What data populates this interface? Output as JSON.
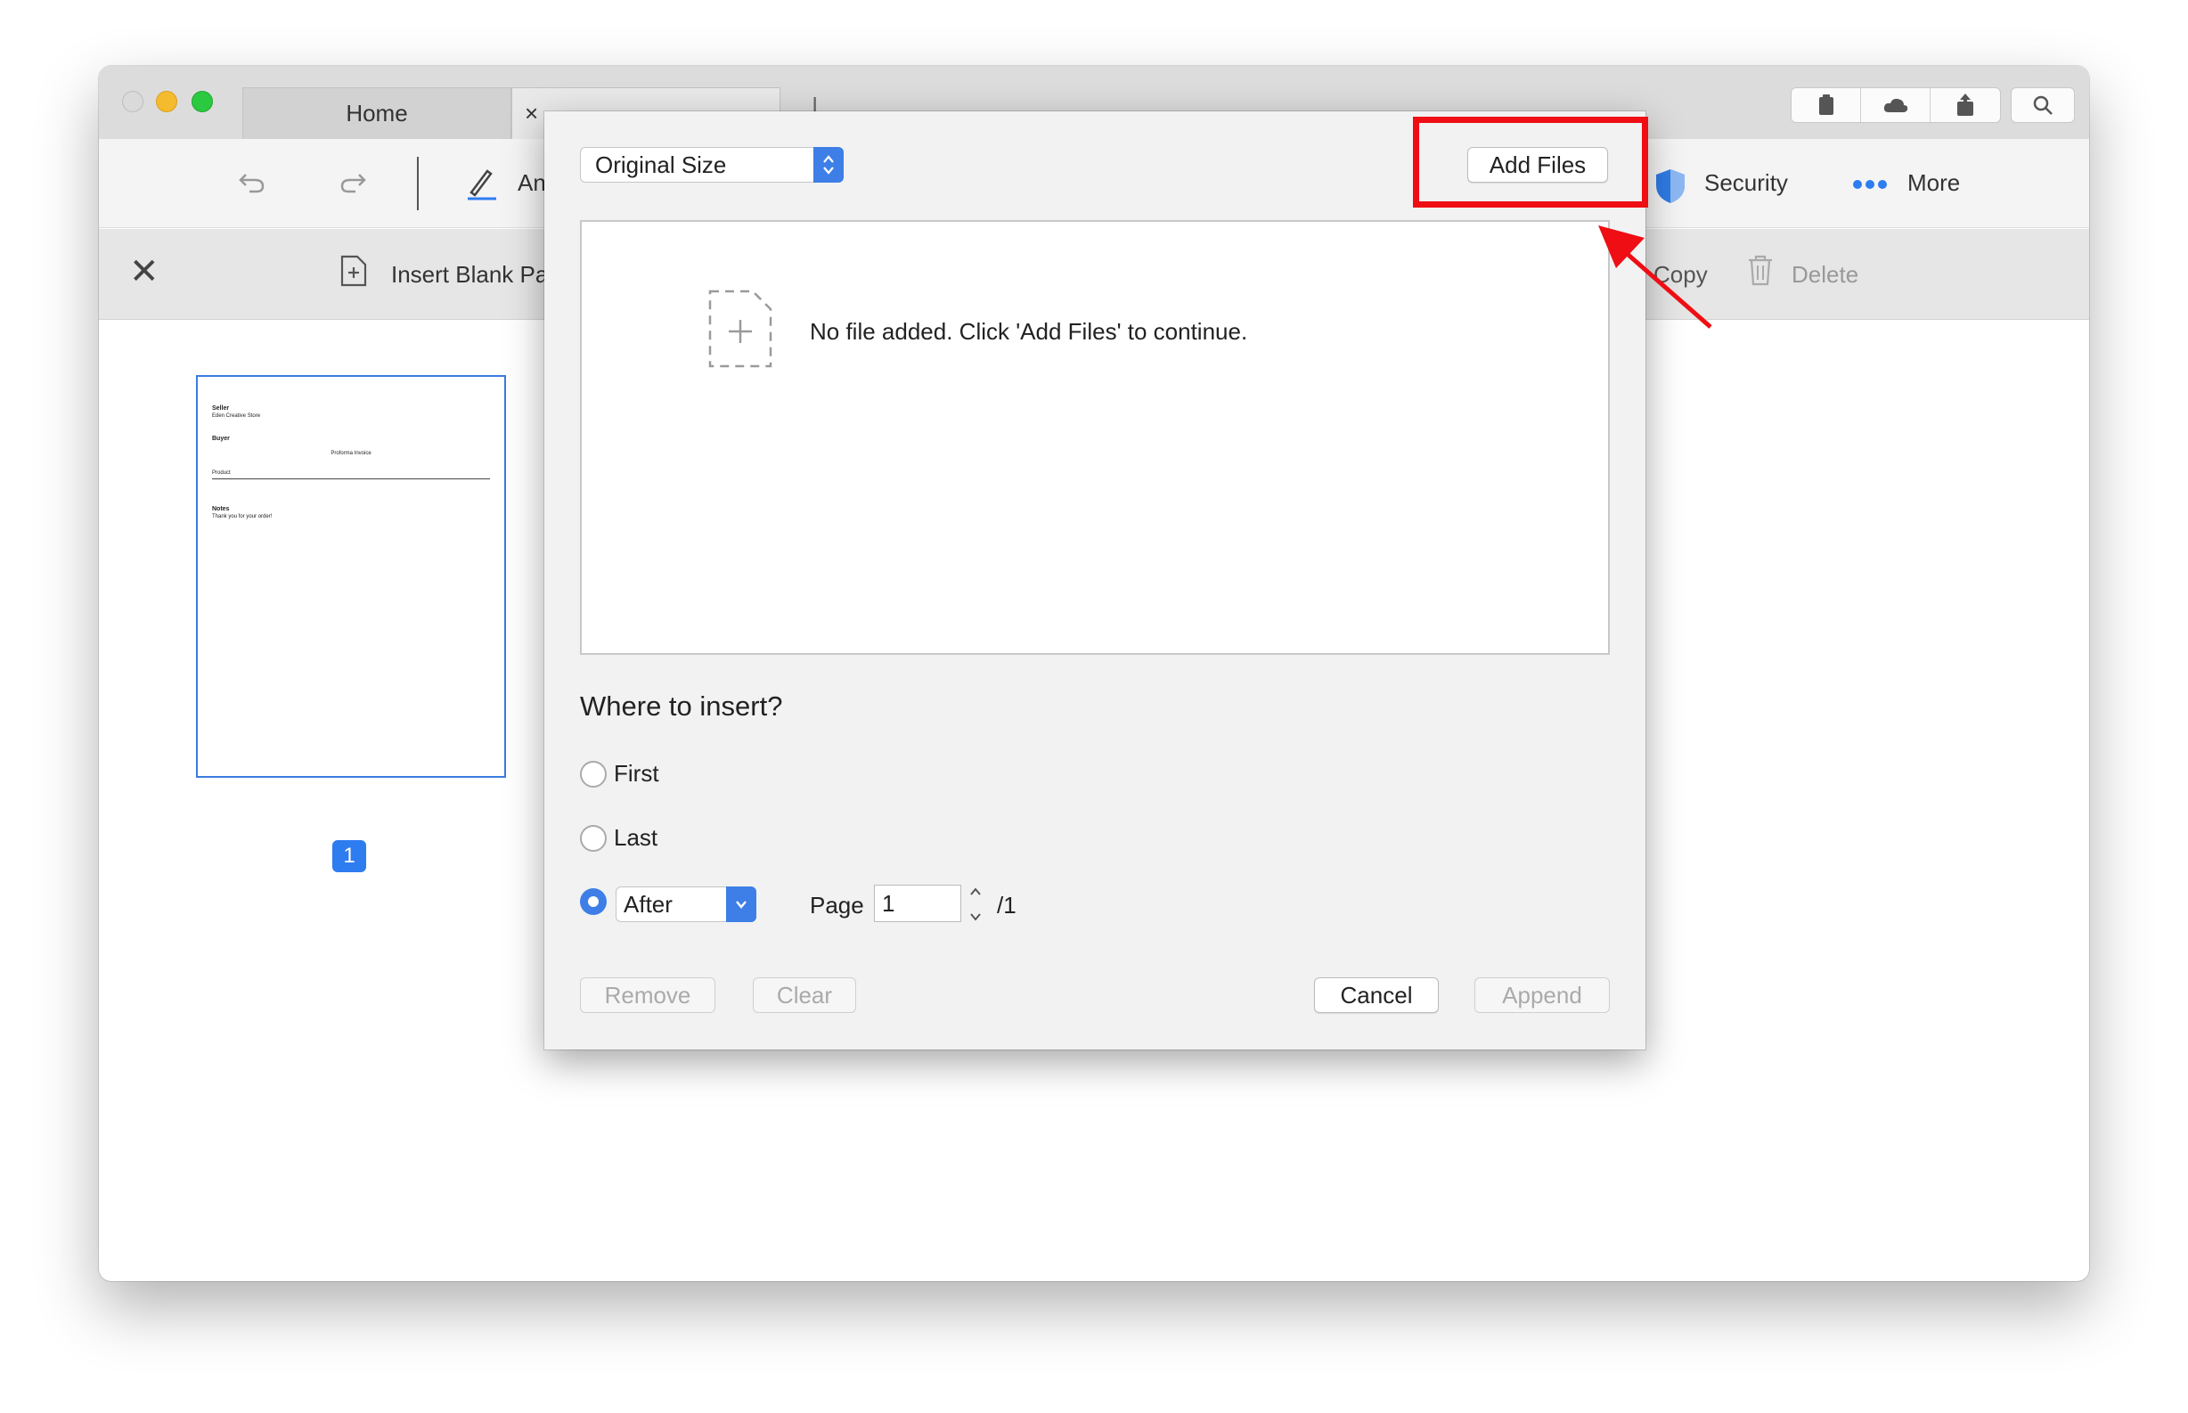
{
  "tabs": [
    {
      "label": "Home"
    },
    {
      "label": "×"
    }
  ],
  "toolbar": {
    "annotate_partial": "An",
    "security_label": "Security",
    "more_label": "More"
  },
  "pagebar": {
    "close_glyph": "✕",
    "insert_blank_label": "Insert Blank Pa",
    "copy_label": "Copy",
    "delete_label": "Delete"
  },
  "thumbnail": {
    "lines": [
      {
        "text": "Seller",
        "bold": true
      },
      {
        "text": "Eden Creative Store",
        "bold": false
      },
      {
        "text": "Buyer",
        "bold": true
      },
      {
        "text": "Proforma Invoice",
        "bold": false
      },
      {
        "text": "Product",
        "bold": false
      },
      {
        "text": "Notes",
        "bold": true
      },
      {
        "text": "Thank you for your order!",
        "bold": false
      }
    ],
    "page_number": "1"
  },
  "dialog": {
    "size_select_value": "Original Size",
    "add_files_label": "Add Files",
    "empty_message": "No file added. Click 'Add Files' to continue.",
    "where_heading": "Where to insert?",
    "options": {
      "first": "First",
      "last": "Last"
    },
    "selected_option": "after",
    "after_select_value": "After",
    "page_label": "Page",
    "page_value": "1",
    "page_total": "/1",
    "remove_label": "Remove",
    "clear_label": "Clear",
    "cancel_label": "Cancel",
    "append_label": "Append"
  },
  "colors": {
    "accent": "#3d7fe6",
    "highlight": "#ee0e14",
    "badge": "#2d7cf0",
    "security_shield": "#2f7be5"
  },
  "icons": [
    "undo-icon",
    "redo-icon",
    "pen-icon",
    "shield-icon",
    "more-icon",
    "insert-page-icon",
    "trash-icon",
    "file-add-icon",
    "clipboard-icon",
    "cloud-icon",
    "share-icon",
    "search-icon"
  ]
}
